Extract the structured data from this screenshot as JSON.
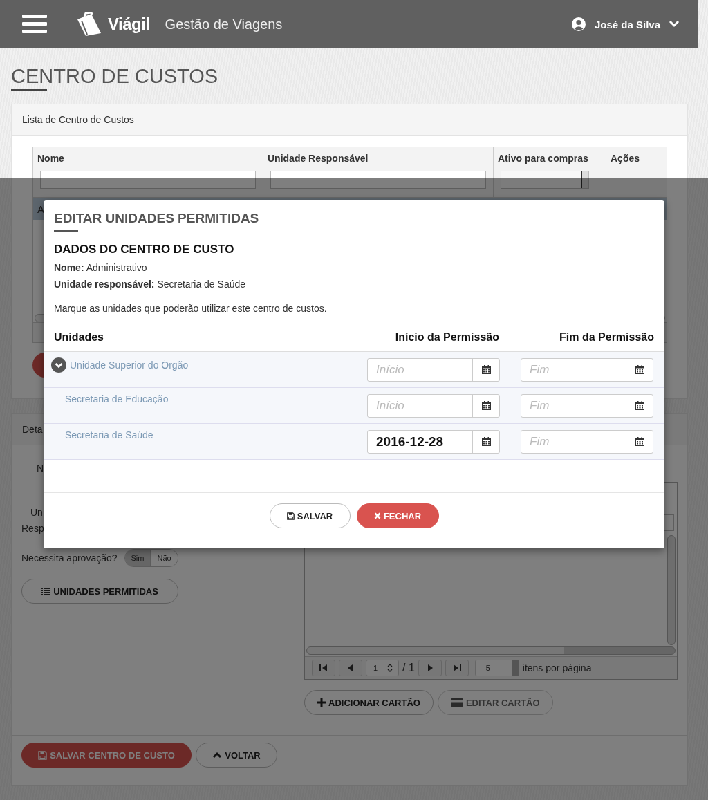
{
  "header": {
    "brand": "Viágil",
    "subtitle": "Gestão de Viagens",
    "user": "José da Silva"
  },
  "page_title": "CENTRO DE CUSTOS",
  "list_panel": {
    "title": "Lista de Centro de Custos",
    "columns": [
      "Nome",
      "Unidade Responsável",
      "Ativo para compras",
      "Ações"
    ],
    "rows": [
      {
        "cell": "A",
        "selected": true
      }
    ]
  },
  "details_panel": {
    "title": "Deta",
    "labels": [
      "N",
      "Un",
      "Resp"
    ],
    "approval_label": "Necessita aprovação?",
    "approval_options": [
      {
        "label": "Sim",
        "selected": true
      },
      {
        "label": "Não",
        "selected": false
      }
    ],
    "units_button": "UNIDADES PERMITIDAS",
    "pager": {
      "page": "1",
      "of": "/ 1",
      "page_size": "5",
      "page_size_label": "itens por página"
    },
    "card_buttons": [
      {
        "label": "ADICIONAR CARTÃO",
        "disabled": false
      },
      {
        "label": "EDITAR CARTÃO",
        "disabled": true
      }
    ],
    "footer_buttons": [
      {
        "label": "SALVAR CENTRO DE CUSTO",
        "kind": "danger"
      },
      {
        "label": "VOLTAR",
        "kind": "default"
      }
    ]
  },
  "modal": {
    "title": "EDITAR UNIDADES PERMITIDAS",
    "section_title": "DADOS DO CENTRO DE CUSTO",
    "info": [
      "**Nome:** Administrativo",
      "**Unidade responsável:** Secretaria de Saúde"
    ],
    "instructions": "Marque as unidades que poderão utilizar este centro de custos.",
    "columns": [
      "Unidades",
      "Início da Permissão",
      "Fim da Permissão"
    ],
    "units": [
      {
        "name": "Unidade Superior do Órgão",
        "expanded": true,
        "start": {
          "placeholder": "Início"
        },
        "end": {
          "placeholder": "Fim"
        },
        "children": [
          {
            "name": "Secretaria de Educação",
            "start": {
              "placeholder": "Início"
            },
            "end": {
              "placeholder": "Fim"
            }
          },
          {
            "name": "Secretaria de Saúde",
            "start": {
              "value": "2016-12-28"
            },
            "end": {
              "placeholder": "Fim"
            }
          }
        ]
      }
    ],
    "buttons": [
      {
        "label": "SALVAR",
        "kind": "default"
      },
      {
        "label": "FECHAR",
        "kind": "danger"
      }
    ]
  }
}
